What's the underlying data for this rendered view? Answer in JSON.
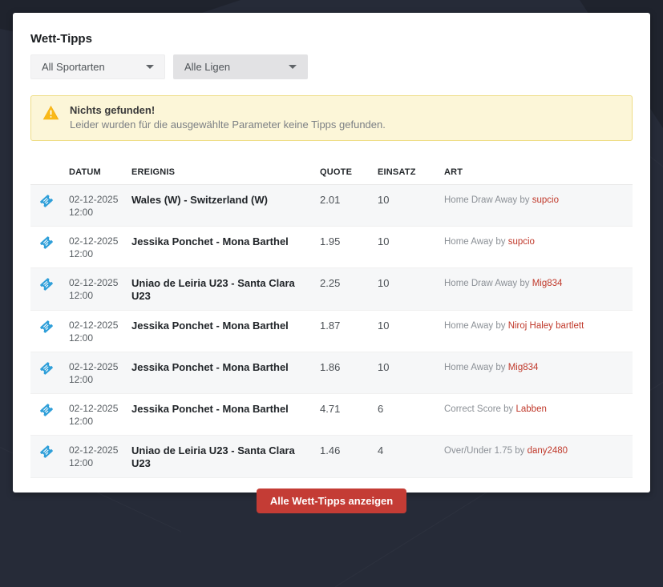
{
  "page": {
    "title": "Wett-Tipps",
    "bg_color": "#262b38",
    "card_color": "#ffffff"
  },
  "filters": {
    "sport": {
      "selected": "All Sportarten"
    },
    "league": {
      "selected": "Alle Ligen"
    }
  },
  "alert": {
    "title": "Nichts gefunden!",
    "message": "Leider wurden für die ausgewählte Parameter keine Tipps gefunden.",
    "bg_color": "#fcf6d8",
    "border_color": "#eedd84",
    "icon": "warning-triangle",
    "icon_color": "#f5ae17"
  },
  "table": {
    "headers": [
      "DATUM",
      "EREIGNIS",
      "QUOTE",
      "EINSATZ",
      "ART"
    ],
    "row_icon": "ticket",
    "row_icon_color": "#2f9fd9",
    "rows": [
      {
        "date": "02-12-2025",
        "time": "12:00",
        "event": "Wales (W) - Switzerland (W)",
        "quote": "2.01",
        "einsatz": "10",
        "art": "Home Draw Away by ",
        "tipster": "supcio"
      },
      {
        "date": "02-12-2025",
        "time": "12:00",
        "event": "Jessika Ponchet - Mona Barthel",
        "quote": "1.95",
        "einsatz": "10",
        "art": "Home Away by ",
        "tipster": "supcio"
      },
      {
        "date": "02-12-2025",
        "time": "12:00",
        "event": "Uniao de Leiria U23 - Santa Clara U23",
        "quote": "2.25",
        "einsatz": "10",
        "art": "Home Draw Away by ",
        "tipster": "Mig834"
      },
      {
        "date": "02-12-2025",
        "time": "12:00",
        "event": "Jessika Ponchet - Mona Barthel",
        "quote": "1.87",
        "einsatz": "10",
        "art": "Home Away by ",
        "tipster": "Niroj Haley bartlett"
      },
      {
        "date": "02-12-2025",
        "time": "12:00",
        "event": "Jessika Ponchet - Mona Barthel",
        "quote": "1.86",
        "einsatz": "10",
        "art": "Home Away by ",
        "tipster": "Mig834"
      },
      {
        "date": "02-12-2025",
        "time": "12:00",
        "event": "Jessika Ponchet - Mona Barthel",
        "quote": "4.71",
        "einsatz": "6",
        "art": "Correct Score by ",
        "tipster": "Labben"
      },
      {
        "date": "02-12-2025",
        "time": "12:00",
        "event": "Uniao de Leiria U23 - Santa Clara U23",
        "quote": "1.46",
        "einsatz": "4",
        "art": "Over/Under 1.75 by ",
        "tipster": "dany2480"
      }
    ]
  },
  "footer": {
    "button_label": "Alle Wett-Tipps anzeigen",
    "button_color": "#c43c35"
  },
  "colors": {
    "tipster_link": "#c0392b",
    "stripe": "#f6f7f8"
  }
}
